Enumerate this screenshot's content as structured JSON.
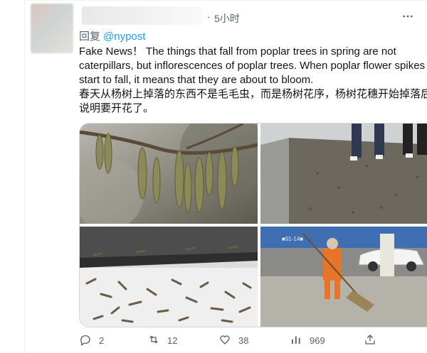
{
  "tweet": {
    "time_dot": "·",
    "time": "5小时",
    "reply_prefix": "回复",
    "reply_handle": "@nypost",
    "text": "Fake News！ The things that fall from poplar trees in spring are not caterpillars, but inflorescences of poplar trees. When poplar flower spikes start to fall, it means that they are about to bloom.\n春天从杨树上掉落的东西不是毛毛虫，而是杨树花序，杨树花穗开始掉落后，说明要开花了。",
    "banner_text": "■91-14■"
  },
  "actions": {
    "reply_count": "2",
    "retweet_count": "12",
    "like_count": "38",
    "view_count": "969"
  },
  "icons": {
    "more": "more-icon",
    "reply": "reply-icon",
    "retweet": "retweet-icon",
    "like": "heart-icon",
    "views": "views-icon",
    "share": "share-icon"
  },
  "colors": {
    "accent": "#1d9bf0",
    "secondary_text": "#536471",
    "primary_text": "#0f1419",
    "border": "#cfd9de"
  }
}
